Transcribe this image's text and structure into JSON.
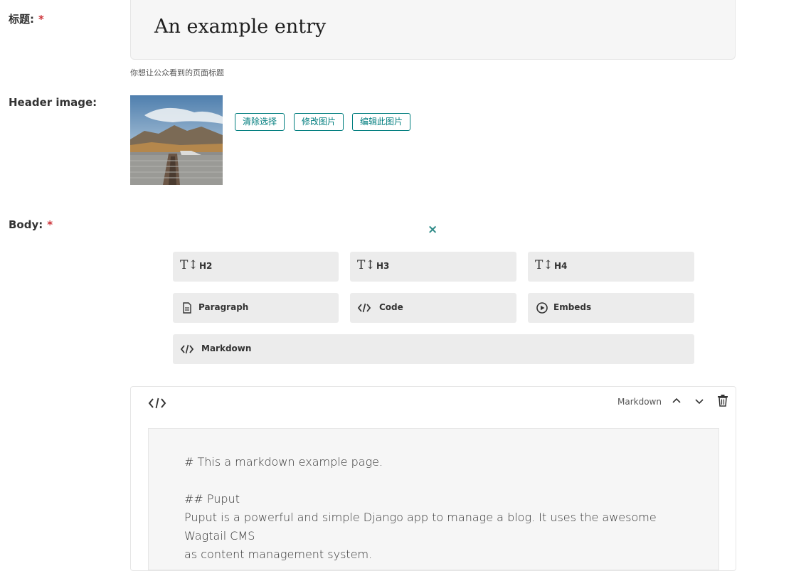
{
  "fields": {
    "title_label": "标题:",
    "required_mark": "*",
    "title_value": "An example entry",
    "title_help": "你想让公众看到的页面标题",
    "header_image_label": "Header image:",
    "body_label": "Body:"
  },
  "image_actions": {
    "clear": "清除选择",
    "change": "修改图片",
    "edit": "编辑此图片"
  },
  "block_chooser": {
    "close_icon": "×",
    "blocks": [
      {
        "label": "H2",
        "icon": "heading-icon"
      },
      {
        "label": "H3",
        "icon": "heading-icon"
      },
      {
        "label": "H4",
        "icon": "heading-icon"
      },
      {
        "label": "Paragraph",
        "icon": "document-icon"
      },
      {
        "label": "Code",
        "icon": "code-icon"
      },
      {
        "label": "Embeds",
        "icon": "media-icon"
      },
      {
        "label": "Markdown",
        "icon": "code-icon"
      }
    ]
  },
  "markdown_block": {
    "type_label": "Markdown",
    "icon": "code-icon",
    "lines": [
      "# This a markdown example page.",
      "",
      "## Puput",
      "Puput is a powerful and simple Django app to manage a blog. It uses the awesome Wagtail CMS",
      "as content management system."
    ]
  },
  "colors": {
    "accent": "#007d7e",
    "required": "#cd3238",
    "button_bg": "#ececec"
  }
}
